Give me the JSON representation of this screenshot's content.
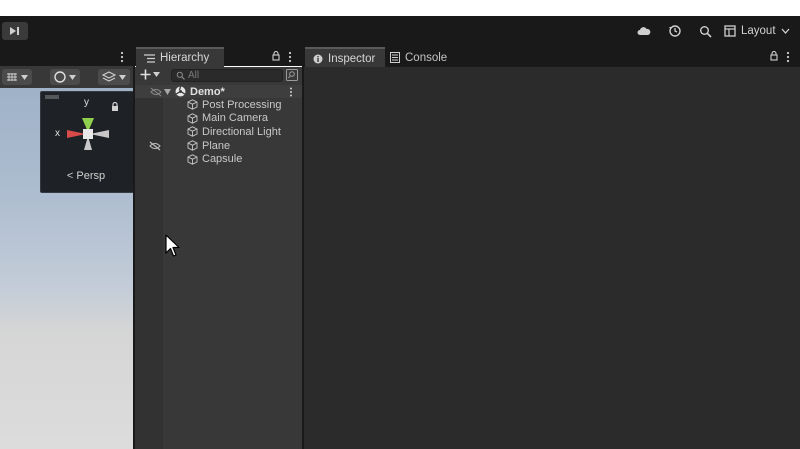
{
  "toolbar": {
    "icons": [
      "step-icon",
      "cloud-icon",
      "history-icon",
      "search-icon"
    ],
    "layout_label": "Layout"
  },
  "scene": {
    "gizmo_axes": [
      "y",
      "x"
    ],
    "projection_label": "Persp"
  },
  "hierarchy": {
    "tab_label": "Hierarchy",
    "search_placeholder": "All",
    "scene_name": "Demo*",
    "items": [
      {
        "label": "Post Processing"
      },
      {
        "label": "Main Camera"
      },
      {
        "label": "Directional Light"
      },
      {
        "label": "Plane"
      },
      {
        "label": "Capsule"
      }
    ]
  },
  "inspector": {
    "tab_label": "Inspector",
    "console_label": "Console"
  },
  "colors": {
    "toolbar_bg": "#191919",
    "panel_bg": "#383838",
    "inspector_bg": "#2b2b2b",
    "gizmo_x": "#d94a4a",
    "gizmo_y": "#8fd14f"
  }
}
